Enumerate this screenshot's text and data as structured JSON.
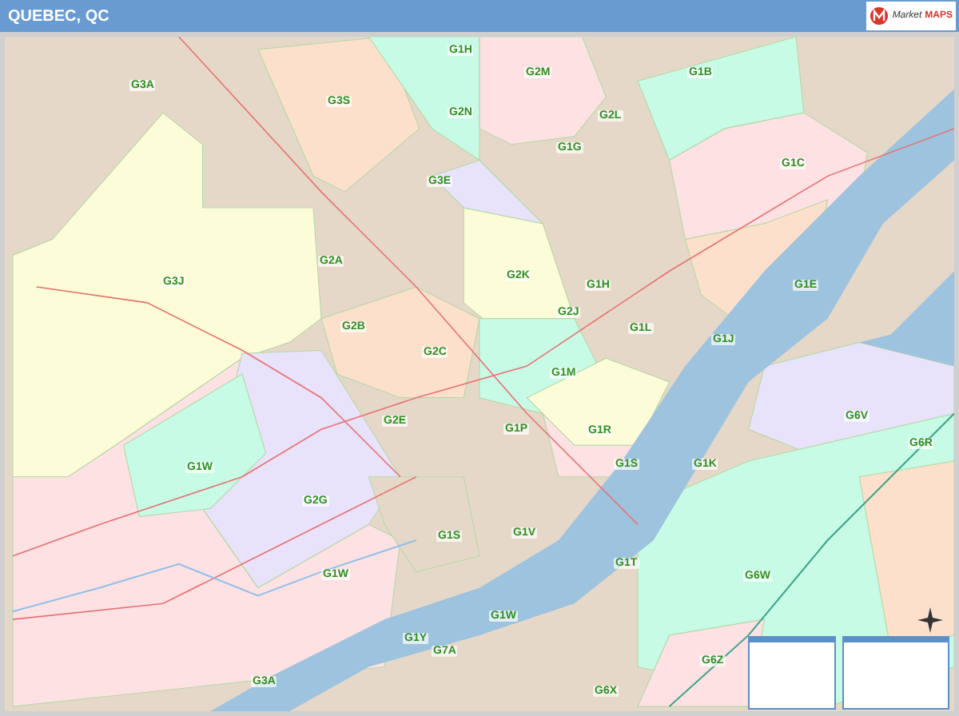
{
  "title": "QUEBEC, QC",
  "logo": {
    "word_1": "Market",
    "word_2": "MAPS"
  },
  "map": {
    "labels": [
      "G3A",
      "G3S",
      "G1H",
      "G2N",
      "G3E",
      "G3J",
      "G2A",
      "G2B",
      "G2C",
      "G2M",
      "G1B",
      "G2L",
      "G1G",
      "G1C",
      "G2K",
      "G1H",
      "G2J",
      "G1L",
      "G1J",
      "G1E",
      "G2E",
      "G1W",
      "G2G",
      "G1S",
      "G1W",
      "G1Y",
      "G7A",
      "G3A",
      "G1M",
      "G1P",
      "G1R",
      "G1S",
      "G1K",
      "G6V",
      "G6R",
      "G1V",
      "G1T",
      "G6W",
      "G1W",
      "G6Z",
      "G6X"
    ]
  }
}
